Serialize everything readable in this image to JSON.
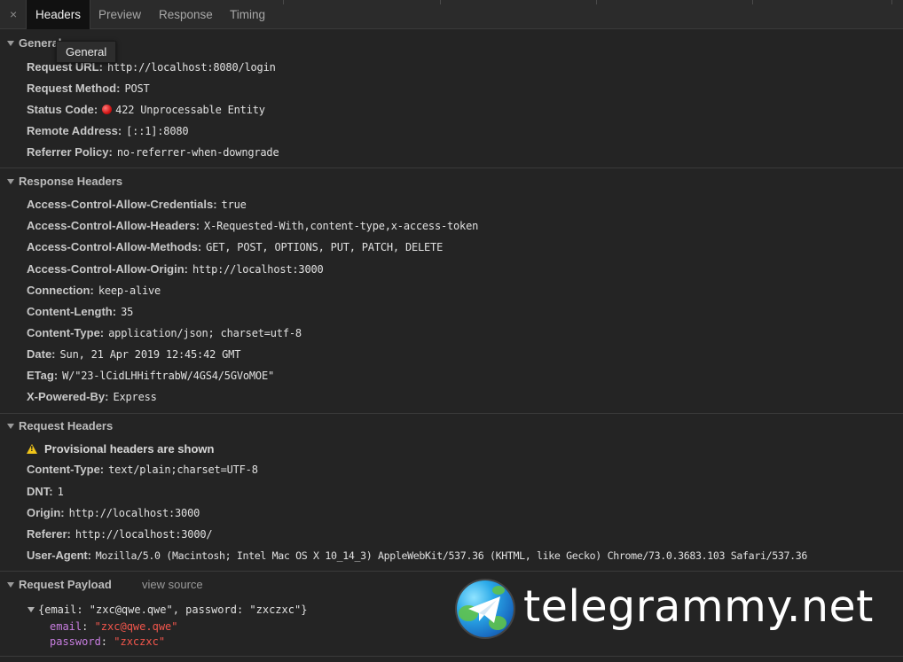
{
  "tabs": [
    {
      "label": "Headers",
      "active": true
    },
    {
      "label": "Preview",
      "active": false
    },
    {
      "label": "Response",
      "active": false
    },
    {
      "label": "Timing",
      "active": false
    }
  ],
  "close_glyph": "×",
  "tooltip": "General",
  "general": {
    "title": "General",
    "rows": [
      {
        "name": "Request URL:",
        "value": "http://localhost:8080/login"
      },
      {
        "name": "Request Method:",
        "value": "POST"
      },
      {
        "name": "Status Code:",
        "value": "422 Unprocessable Entity",
        "status_color": "#e0231b"
      },
      {
        "name": "Remote Address:",
        "value": "[::1]:8080"
      },
      {
        "name": "Referrer Policy:",
        "value": "no-referrer-when-downgrade"
      }
    ]
  },
  "response_headers": {
    "title": "Response Headers",
    "rows": [
      {
        "name": "Access-Control-Allow-Credentials:",
        "value": "true"
      },
      {
        "name": "Access-Control-Allow-Headers:",
        "value": "X-Requested-With,content-type,x-access-token"
      },
      {
        "name": "Access-Control-Allow-Methods:",
        "value": "GET, POST, OPTIONS, PUT, PATCH, DELETE"
      },
      {
        "name": "Access-Control-Allow-Origin:",
        "value": "http://localhost:3000"
      },
      {
        "name": "Connection:",
        "value": "keep-alive"
      },
      {
        "name": "Content-Length:",
        "value": "35"
      },
      {
        "name": "Content-Type:",
        "value": "application/json; charset=utf-8"
      },
      {
        "name": "Date:",
        "value": "Sun, 21 Apr 2019 12:45:42 GMT"
      },
      {
        "name": "ETag:",
        "value": "W/\"23-lCidLHHiftrabW/4GS4/5GVoMOE\""
      },
      {
        "name": "X-Powered-By:",
        "value": "Express"
      }
    ]
  },
  "request_headers": {
    "title": "Request Headers",
    "warning": "Provisional headers are shown",
    "rows": [
      {
        "name": "Content-Type:",
        "value": "text/plain;charset=UTF-8"
      },
      {
        "name": "DNT:",
        "value": "1"
      },
      {
        "name": "Origin:",
        "value": "http://localhost:3000"
      },
      {
        "name": "Referer:",
        "value": "http://localhost:3000/"
      },
      {
        "name": "User-Agent:",
        "value": "Mozilla/5.0 (Macintosh; Intel Mac OS X 10_14_3) AppleWebKit/537.36 (KHTML, like Gecko) Chrome/73.0.3683.103 Safari/537.36"
      }
    ]
  },
  "request_payload": {
    "title": "Request Payload",
    "view_source": "view source",
    "summary": "{email: \"zxc@qwe.qwe\", password: \"zxczxc\"}",
    "fields": [
      {
        "key": "email",
        "value": "\"zxc@qwe.qwe\""
      },
      {
        "key": "password",
        "value": "\"zxczxc\""
      }
    ]
  },
  "watermark": {
    "text": "telegrammy.net",
    "icon": "telegram-globe-icon"
  },
  "colors": {
    "background": "#242424",
    "active_tab": "#111111",
    "payload_key": "#c87ee0",
    "payload_string": "#f2564c",
    "warning": "#f0c419"
  }
}
